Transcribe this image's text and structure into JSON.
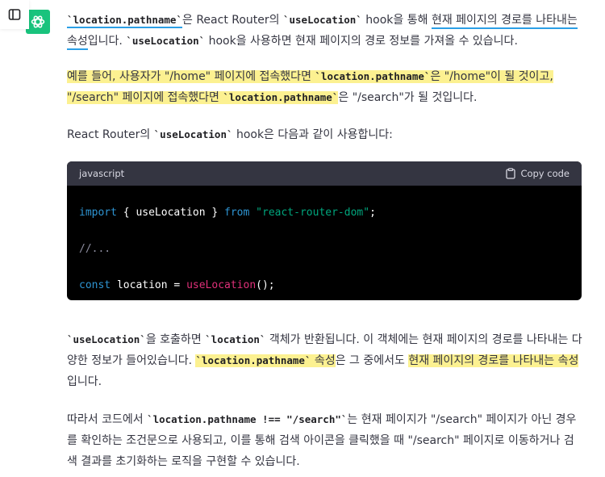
{
  "code_block": {
    "language": "javascript",
    "copy_label": "Copy code",
    "lines": {
      "l1": {
        "kw": "import",
        "a": " { useLocation } ",
        "kw2": "from",
        "b": " ",
        "str": "\"react-router-dom\"",
        "c": ";"
      },
      "l2": {
        "cm": "//..."
      },
      "l3": {
        "kw": "const",
        "a": " location = ",
        "fn": "useLocation",
        "c": "();"
      }
    }
  },
  "paragraphs": {
    "p1": {
      "code1": "`location.pathname`",
      "t1": "은 React Router의 ",
      "code2": "`useLocation`",
      "t2": " hook을 통해 ",
      "ul1": "현재 페이지의 경로를 나타내는",
      "ul2": "속성",
      "t3": "입니다. ",
      "code3": "`useLocation`",
      "t4": " hook을 사용하면 현재 페이지의 경로 정보를 가져올 수 있습니다."
    },
    "p2": {
      "t1": "예를 들어, 사용자가 \"/home\" 페이지에 접속했다면 ",
      "code1": "`location.pathname`",
      "t2": "은 \"/home\"이 될 것이고,",
      "t3": "\"/search\" 페이지에 접속했다면 ",
      "code2": "`location.pathname`",
      "t4": "은 \"/search\"가 될 것입니다."
    },
    "p3": {
      "t1": "React Router의 ",
      "code1": "`useLocation`",
      "t2": " hook은 다음과 같이 사용합니다:"
    },
    "p4": {
      "code1": "`useLocation`",
      "t1": "을 호출하면 ",
      "code2": "`location`",
      "t2": " 객체가 반환됩니다. 이 객체에는 현재 페이지의 경로를 나타내는 다양한 정보가 들어있습니다. ",
      "code3": "`location.pathname`",
      "t3": " 속성",
      "t4": "은 그 중에서도 ",
      "t5": "현재 페이지의 경로를 나타내는 속성",
      "t6": " 입니다."
    },
    "p5": {
      "t1": "따라서 코드에서 ",
      "code1": "`location.pathname !== \"/search\"`",
      "t2": "는 현재 페이지가 \"/search\" 페이지가 아닌 경우를 확인하는 조건문으로 사용되고, 이를 통해 검색 아이콘을 클릭했을 때 \"/search\" 페이지로 이동하거나 검색 결과를 초기화하는 로직을 구현할 수 있습니다."
    }
  },
  "colors": {
    "highlight": "#fcf191",
    "underline": "#2b9fe6",
    "avatar": "#19c37d",
    "code_bg": "#000000",
    "code_header": "#343541"
  },
  "icons": {
    "sidebar": "sidebar-toggle-icon",
    "avatar": "openai-logo-icon",
    "copy": "clipboard-icon"
  }
}
